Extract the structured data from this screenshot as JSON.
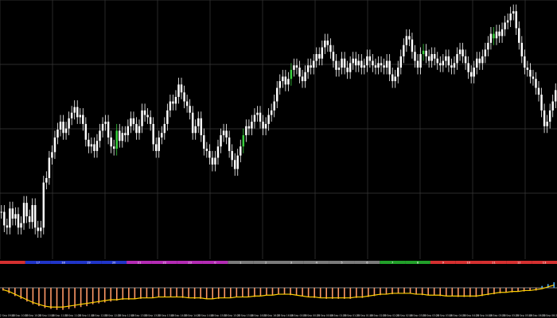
{
  "chart_data": {
    "type": "candlestick",
    "grid": true,
    "colors": {
      "background": "#000000",
      "grid": "#3a3a3a",
      "candle": "#ffffff",
      "candle_highlight": "#39d13e",
      "histogram_pos": "#ff9966",
      "histogram_neg": "#ff9966",
      "histogram_up": "#4fb3ff",
      "signal_line": "#ffd000",
      "zero_line": "#ffffff"
    },
    "session_bar": [
      {
        "label": "",
        "color": "#d43030"
      },
      {
        "label": "17",
        "color": "#2035c8"
      },
      {
        "label": "18",
        "color": "#2035c8"
      },
      {
        "label": "19",
        "color": "#2035c8"
      },
      {
        "label": "20",
        "color": "#2035c8"
      },
      {
        "label": "21",
        "color": "#b32bb3"
      },
      {
        "label": "22",
        "color": "#b32bb3"
      },
      {
        "label": "23",
        "color": "#b32bb3"
      },
      {
        "label": "0",
        "color": "#b32bb3"
      },
      {
        "label": "1",
        "color": "#7a7a7a"
      },
      {
        "label": "2",
        "color": "#7a7a7a"
      },
      {
        "label": "3",
        "color": "#7a7a7a"
      },
      {
        "label": "4",
        "color": "#7a7a7a"
      },
      {
        "label": "5",
        "color": "#7a7a7a"
      },
      {
        "label": "6",
        "color": "#7a7a7a"
      },
      {
        "label": "7",
        "color": "#22a02a"
      },
      {
        "label": "8",
        "color": "#22a02a"
      },
      {
        "label": "9",
        "color": "#d43030"
      },
      {
        "label": "10",
        "color": "#d43030"
      },
      {
        "label": "11",
        "color": "#d43030"
      },
      {
        "label": "12",
        "color": "#d43030"
      },
      {
        "label": "13",
        "color": "#d43030"
      }
    ],
    "x_tick_labels": [
      "22 Sep 09:40",
      "22 Sep 10:00",
      "22 Sep 10:20",
      "22 Sep 10:40",
      "22 Sep 11:00",
      "22 Sep 11:20",
      "22 Sep 11:40",
      "22 Sep 12:00",
      "22 Sep 12:20",
      "22 Sep 12:40",
      "22 Sep 13:00",
      "22 Sep 13:20",
      "22 Sep 13:40",
      "22 Sep 14:00",
      "22 Sep 14:20",
      "22 Sep 14:40",
      "22 Sep 15:00",
      "22 Sep 15:20",
      "22 Sep 15:40",
      "22 Sep 16:00",
      "22 Sep 16:20",
      "22 Sep 16:40",
      "23 Sep 00:00",
      "23 Sep 00:20",
      "23 Sep 00:40",
      "23 Sep 01:00",
      "23 Sep 01:20",
      "23 Sep 01:40",
      "23 Sep 02:00",
      "23 Sep 02:20",
      "23 Sep 02:40",
      "23 Sep 03:00",
      "23 Sep 03:20",
      "23 Sep 03:40",
      "23 Sep 04:00",
      "23 Sep 04:20",
      "23 Sep 04:40",
      "23 Sep 05:00",
      "23 Sep 05:20",
      "23 Sep 05:40",
      "23 Sep 06:00",
      "23 Sep 06:20"
    ],
    "price_series": [
      142,
      130,
      128,
      145,
      136,
      140,
      128,
      132,
      150,
      138,
      133,
      148,
      128,
      125,
      128,
      168,
      172,
      190,
      195,
      208,
      215,
      222,
      212,
      216,
      225,
      230,
      235,
      226,
      228,
      220,
      206,
      200,
      202,
      196,
      205,
      214,
      220,
      222,
      208,
      200,
      198,
      214,
      205,
      212,
      210,
      218,
      225,
      220,
      212,
      218,
      232,
      228,
      226,
      220,
      202,
      196,
      208,
      212,
      220,
      232,
      240,
      238,
      244,
      255,
      248,
      240,
      236,
      230,
      212,
      218,
      225,
      210,
      198,
      196,
      190,
      184,
      190,
      200,
      210,
      214,
      208,
      196,
      188,
      180,
      192,
      200,
      210,
      218,
      216,
      222,
      228,
      230,
      222,
      216,
      220,
      228,
      232,
      240,
      252,
      258,
      262,
      255,
      260,
      268,
      272,
      270,
      262,
      258,
      266,
      272,
      270,
      276,
      282,
      278,
      288,
      294,
      290,
      284,
      276,
      268,
      270,
      278,
      270,
      266,
      274,
      278,
      272,
      276,
      270,
      272,
      280,
      276,
      272,
      270,
      274,
      272,
      270,
      276,
      264,
      258,
      262,
      270,
      280,
      290,
      298,
      295,
      284,
      276,
      270,
      282,
      285,
      280,
      276,
      282,
      278,
      274,
      272,
      276,
      280,
      272,
      270,
      274,
      282,
      286,
      280,
      274,
      266,
      262,
      270,
      278,
      274,
      280,
      286,
      292,
      300,
      296,
      302,
      298,
      304,
      310,
      312,
      318,
      320,
      305,
      292,
      280,
      270,
      268,
      262,
      260,
      252,
      246,
      232,
      218,
      222,
      232,
      240,
      250
    ],
    "highlight_indices": [
      41,
      86,
      103,
      150,
      175
    ],
    "histogram": [
      -3,
      -6,
      -9,
      -12,
      -15,
      -18,
      -20,
      -22,
      -23,
      -24,
      -24,
      -23,
      -22,
      -21,
      -20,
      -18,
      -17,
      -16,
      -15,
      -14,
      -13,
      -13,
      -12,
      -12,
      -11,
      -11,
      -10,
      -10,
      -10,
      -10,
      -11,
      -11,
      -12,
      -12,
      -12,
      -12,
      -12,
      -11,
      -11,
      -10,
      -10,
      -10,
      -10,
      -9,
      -8,
      -8,
      -7,
      -7,
      -8,
      -8,
      -9,
      -10,
      -11,
      -11,
      -12,
      -12,
      -12,
      -12,
      -12,
      -11,
      -11,
      -10,
      -9,
      -8,
      -7,
      -7,
      -6,
      -6,
      -6,
      -7,
      -8,
      -8,
      -8,
      -9,
      -9,
      -9,
      -10,
      -10,
      -10,
      -10,
      -9,
      -8,
      -7,
      -6,
      -5,
      -5,
      -4,
      -4,
      -3,
      -3,
      2,
      4,
      6
    ],
    "signal_line": [
      -2,
      -4,
      -7,
      -10,
      -13,
      -16,
      -18,
      -20,
      -21,
      -21,
      -21,
      -20,
      -19,
      -18,
      -17,
      -16,
      -15,
      -14,
      -13,
      -13,
      -12,
      -12,
      -12,
      -11,
      -11,
      -11,
      -10,
      -10,
      -10,
      -10,
      -10,
      -11,
      -11,
      -11,
      -12,
      -12,
      -11,
      -11,
      -11,
      -10,
      -10,
      -10,
      -9,
      -9,
      -8,
      -8,
      -7,
      -7,
      -7,
      -8,
      -9,
      -10,
      -10,
      -11,
      -11,
      -11,
      -11,
      -11,
      -11,
      -10,
      -10,
      -9,
      -8,
      -7,
      -7,
      -6,
      -6,
      -6,
      -6,
      -7,
      -7,
      -8,
      -8,
      -8,
      -9,
      -9,
      -9,
      -9,
      -9,
      -9,
      -8,
      -7,
      -6,
      -5,
      -5,
      -4,
      -4,
      -3,
      -3,
      -2,
      -1,
      1,
      3
    ]
  }
}
